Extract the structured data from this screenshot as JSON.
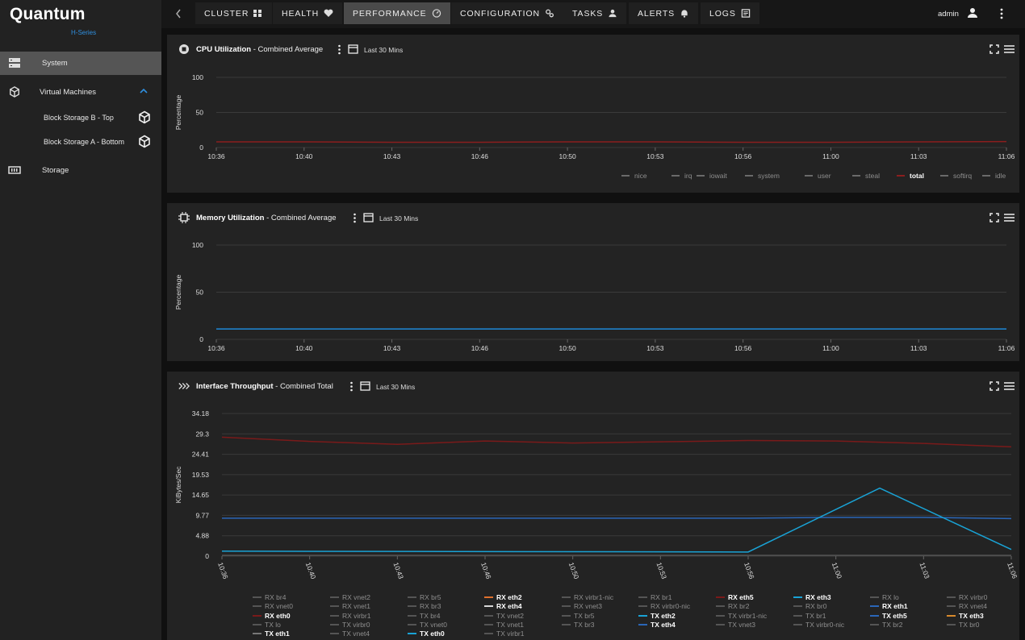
{
  "brand": {
    "name": "Quantum",
    "series": "H-Series"
  },
  "sidebar": {
    "items": [
      {
        "label": "System"
      },
      {
        "label": "Virtual Machines"
      },
      {
        "label": "Block Storage B - Top"
      },
      {
        "label": "Block Storage A - Bottom"
      },
      {
        "label": "Storage"
      }
    ]
  },
  "nav": {
    "tabs": [
      {
        "label": "CLUSTER"
      },
      {
        "label": "HEALTH"
      },
      {
        "label": "PERFORMANCE"
      },
      {
        "label": "CONFIGURATION"
      },
      {
        "label": "TASKS"
      },
      {
        "label": "ALERTS"
      },
      {
        "label": "LOGS"
      }
    ],
    "user": "admin"
  },
  "panels": [
    {
      "title": "CPU Utilization",
      "subtitle": " - Combined Average",
      "range": "Last 30 Mins"
    },
    {
      "title": "Memory Utilization",
      "subtitle": " - Combined Average",
      "range": "Last 30 Mins"
    },
    {
      "title": "Interface Throughput",
      "subtitle": " - Combined Total",
      "range": "Last 30 Mins"
    }
  ],
  "colors": {
    "accent": "#2f8fdf",
    "total": "#8b1e1e",
    "memory": "#1e88d8",
    "txeth0": "#19a3d6",
    "rxeth0": "#7a1a1a",
    "bg": "#232323"
  },
  "chart_data": [
    {
      "type": "line",
      "ylabel": "Percentage",
      "x": [
        "10:36",
        "10:40",
        "10:43",
        "10:46",
        "10:50",
        "10:53",
        "10:56",
        "11:00",
        "11:03",
        "11:06"
      ],
      "ylim": [
        0,
        100
      ],
      "yticks": [
        "100",
        "50",
        "0"
      ],
      "series": [
        {
          "name": "nice",
          "values": [
            0,
            0,
            0,
            0,
            0,
            0,
            0,
            0,
            0,
            0
          ]
        },
        {
          "name": "irq",
          "values": [
            0,
            0,
            0,
            0,
            0,
            0,
            0,
            0,
            0,
            0
          ]
        },
        {
          "name": "iowait",
          "values": [
            0,
            0,
            0,
            0,
            0,
            0,
            0,
            0,
            0,
            0
          ]
        },
        {
          "name": "system",
          "values": [
            0,
            0,
            0,
            0,
            0,
            0,
            0,
            0,
            0,
            0
          ]
        },
        {
          "name": "user",
          "values": [
            0,
            0,
            0,
            0,
            0,
            0,
            0,
            0,
            0,
            0
          ]
        },
        {
          "name": "steal",
          "values": [
            0,
            0,
            0,
            0,
            0,
            0,
            0,
            0,
            0,
            0
          ]
        },
        {
          "name": "total",
          "values": [
            8,
            8,
            7.5,
            7.5,
            8,
            8,
            7.5,
            7.5,
            8,
            8.5
          ]
        },
        {
          "name": "softirq",
          "values": [
            0,
            0,
            0,
            0,
            0,
            0,
            0,
            0,
            0,
            0
          ]
        },
        {
          "name": "idle",
          "values": [
            0,
            0,
            0,
            0,
            0,
            0,
            0,
            0,
            0,
            0
          ]
        }
      ],
      "visible": [
        "total"
      ],
      "legend": "bottom"
    },
    {
      "type": "line",
      "ylabel": "Percentage",
      "x": [
        "10:36",
        "10:40",
        "10:43",
        "10:46",
        "10:50",
        "10:53",
        "10:56",
        "11:00",
        "11:03",
        "11:06"
      ],
      "ylim": [
        0,
        100
      ],
      "yticks": [
        "100",
        "50",
        "0"
      ],
      "series": [
        {
          "name": "memory",
          "values": [
            11,
            11,
            11,
            11,
            11,
            11,
            11,
            11,
            11,
            11
          ]
        }
      ]
    },
    {
      "type": "line",
      "ylabel": "KiBytes/Sec",
      "x": [
        "10:36",
        "10:40",
        "10:43",
        "10:46",
        "10:50",
        "10:53",
        "10:56",
        "11:00",
        "11:03",
        "11:06"
      ],
      "ylim": [
        0,
        34.18
      ],
      "yticks": [
        "34.18",
        "29.3",
        "24.41",
        "19.53",
        "14.65",
        "9.77",
        "4.88",
        "0"
      ],
      "series": [
        {
          "name": "RX eth0",
          "color": "#7a1a1a",
          "values": [
            28.5,
            27.5,
            26.8,
            27.6,
            27.1,
            27.4,
            27.7,
            27.6,
            27.0,
            26.2
          ]
        },
        {
          "name": "TX eth1",
          "color": "#2a66b8",
          "values": [
            9.1,
            9.1,
            9.1,
            9.1,
            9.1,
            9.1,
            9.1,
            9.3,
            9.3,
            9.0
          ]
        },
        {
          "name": "TX eth0",
          "color": "#19a3d6",
          "x_points": [
            0,
            6,
            7.5,
            9
          ],
          "values": [
            1.2,
            1.0,
            16.3,
            1.6
          ]
        },
        {
          "name": "TX lo",
          "color": "#555",
          "values": [
            0.2,
            0.2,
            0.2,
            0.2,
            0.2,
            0.2,
            0.2,
            0.2,
            0.2,
            0.2
          ]
        }
      ],
      "legend_items": [
        [
          "RX br4",
          "RX vnet2",
          "RX br5",
          "RX eth2",
          "RX virbr1-nic",
          "RX br1",
          "RX eth5",
          "RX eth3",
          "RX lo",
          "RX virbr0"
        ],
        [
          "RX vnet0",
          "RX vnet1",
          "RX br3",
          "RX eth4",
          "RX vnet3",
          "RX virbr0-nic",
          "RX br2",
          "RX br0",
          "RX eth1",
          "RX vnet4"
        ],
        [
          "RX eth0",
          "RX virbr1",
          "TX br4",
          "TX vnet2",
          "TX br5",
          "TX eth2",
          "TX virbr1-nic",
          "TX br1",
          "TX eth5",
          "TX eth3"
        ],
        [
          "TX lo",
          "TX virbr0",
          "TX vnet0",
          "TX vnet1",
          "TX br3",
          "TX eth4",
          "TX vnet3",
          "TX virbr0-nic",
          "TX br2",
          "TX br0"
        ],
        [
          "TX eth1",
          "TX vnet4",
          "TX eth0",
          "TX virbr1"
        ]
      ],
      "legend_active": [
        "RX eth2",
        "RX eth4",
        "RX eth0",
        "RX eth5",
        "RX eth3",
        "RX eth1",
        "TX eth2",
        "TX eth4",
        "TX eth5",
        "TX eth3",
        "TX eth1",
        "TX eth0"
      ]
    }
  ]
}
